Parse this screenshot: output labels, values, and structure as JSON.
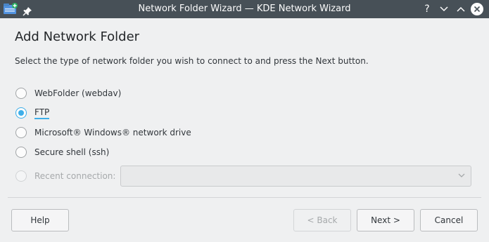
{
  "window": {
    "title": "Network Folder Wizard — KDE Network Wizard",
    "help_glyph": "?"
  },
  "page": {
    "heading": "Add Network Folder",
    "instructions": "Select the type of network folder you wish to connect to and press the Next button."
  },
  "options": [
    {
      "label": "WebFolder (webdav)",
      "checked": false,
      "disabled": false
    },
    {
      "label": "FTP",
      "checked": true,
      "disabled": false
    },
    {
      "label": "Microsoft® Windows® network drive",
      "checked": false,
      "disabled": false
    },
    {
      "label": "Secure shell (ssh)",
      "checked": false,
      "disabled": false
    },
    {
      "label": "Recent connection:",
      "checked": false,
      "disabled": true
    }
  ],
  "recent_connection": {
    "value": ""
  },
  "buttons": {
    "help": "Help",
    "back": "< Back",
    "next": "Next >",
    "cancel": "Cancel"
  },
  "colors": {
    "titlebar": "#475057",
    "accent": "#3daee9",
    "background": "#eff0f1"
  }
}
